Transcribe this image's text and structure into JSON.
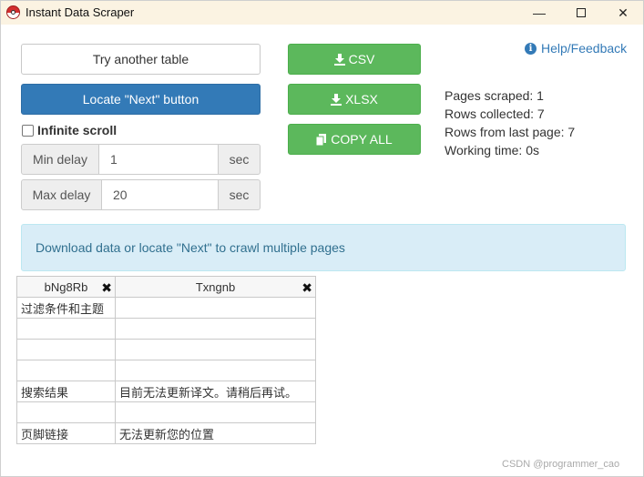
{
  "window": {
    "title": "Instant Data Scraper",
    "minimize_glyph": "—",
    "close_glyph": "✕"
  },
  "buttons": {
    "try_another_table": "Try another table",
    "locate_next": "Locate \"Next\" button",
    "csv": "CSV",
    "xlsx": "XLSX",
    "copy_all": "COPY ALL"
  },
  "help": {
    "label": "Help/Feedback",
    "icon": "info-circle-icon"
  },
  "infinite_scroll": {
    "label": "Infinite scroll",
    "checked": false
  },
  "delays": {
    "min_label": "Min delay",
    "min_value": "1",
    "max_label": "Max delay",
    "max_value": "20",
    "unit": "sec"
  },
  "stats": {
    "pages_scraped": "Pages scraped: 1",
    "rows_collected": "Rows collected: 7",
    "rows_last_page": "Rows from last page: 7",
    "working_time": "Working time: 0s"
  },
  "alert": {
    "message": "Download data or locate \"Next\" to crawl multiple pages"
  },
  "table": {
    "columns": [
      "bNg8Rb",
      "Txngnb"
    ],
    "rows": [
      [
        "过滤条件和主题",
        ""
      ],
      [
        "",
        ""
      ],
      [
        "",
        ""
      ],
      [
        "",
        ""
      ],
      [
        "搜索结果",
        "目前无法更新译文。请稍后再试。"
      ],
      [
        "",
        ""
      ],
      [
        "页脚链接",
        "无法更新您的位置"
      ]
    ]
  },
  "watermark": "CSDN @programmer_cao",
  "colors": {
    "primary": "#337ab7",
    "success": "#5cb85c",
    "alert_bg": "#d9edf7",
    "alert_text": "#31708f",
    "titlebar": "#fbf3e2"
  }
}
